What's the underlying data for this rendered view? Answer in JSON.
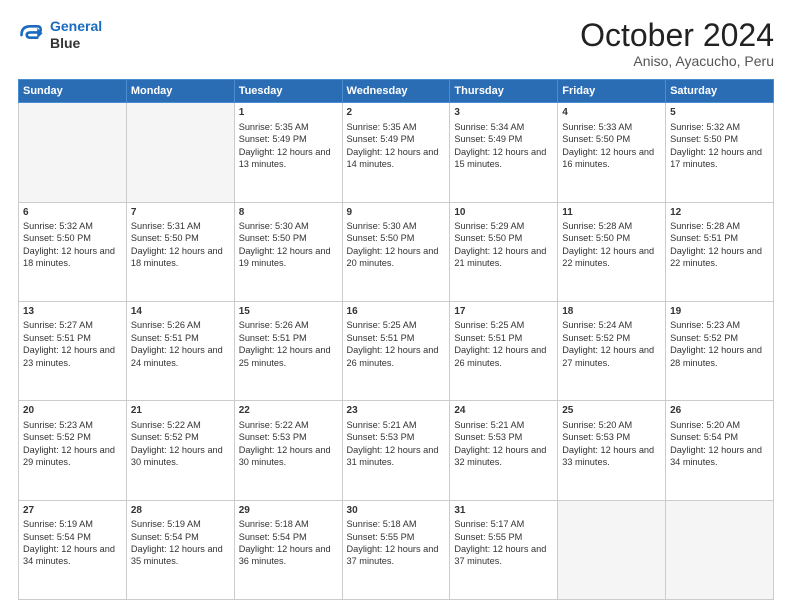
{
  "logo": {
    "line1": "General",
    "line2": "Blue"
  },
  "title": "October 2024",
  "subtitle": "Aniso, Ayacucho, Peru",
  "weekdays": [
    "Sunday",
    "Monday",
    "Tuesday",
    "Wednesday",
    "Thursday",
    "Friday",
    "Saturday"
  ],
  "weeks": [
    [
      {
        "day": "",
        "empty": true
      },
      {
        "day": "",
        "empty": true
      },
      {
        "day": "1",
        "sunrise": "Sunrise: 5:35 AM",
        "sunset": "Sunset: 5:49 PM",
        "daylight": "Daylight: 12 hours and 13 minutes."
      },
      {
        "day": "2",
        "sunrise": "Sunrise: 5:35 AM",
        "sunset": "Sunset: 5:49 PM",
        "daylight": "Daylight: 12 hours and 14 minutes."
      },
      {
        "day": "3",
        "sunrise": "Sunrise: 5:34 AM",
        "sunset": "Sunset: 5:49 PM",
        "daylight": "Daylight: 12 hours and 15 minutes."
      },
      {
        "day": "4",
        "sunrise": "Sunrise: 5:33 AM",
        "sunset": "Sunset: 5:50 PM",
        "daylight": "Daylight: 12 hours and 16 minutes."
      },
      {
        "day": "5",
        "sunrise": "Sunrise: 5:32 AM",
        "sunset": "Sunset: 5:50 PM",
        "daylight": "Daylight: 12 hours and 17 minutes."
      }
    ],
    [
      {
        "day": "6",
        "sunrise": "Sunrise: 5:32 AM",
        "sunset": "Sunset: 5:50 PM",
        "daylight": "Daylight: 12 hours and 18 minutes."
      },
      {
        "day": "7",
        "sunrise": "Sunrise: 5:31 AM",
        "sunset": "Sunset: 5:50 PM",
        "daylight": "Daylight: 12 hours and 18 minutes."
      },
      {
        "day": "8",
        "sunrise": "Sunrise: 5:30 AM",
        "sunset": "Sunset: 5:50 PM",
        "daylight": "Daylight: 12 hours and 19 minutes."
      },
      {
        "day": "9",
        "sunrise": "Sunrise: 5:30 AM",
        "sunset": "Sunset: 5:50 PM",
        "daylight": "Daylight: 12 hours and 20 minutes."
      },
      {
        "day": "10",
        "sunrise": "Sunrise: 5:29 AM",
        "sunset": "Sunset: 5:50 PM",
        "daylight": "Daylight: 12 hours and 21 minutes."
      },
      {
        "day": "11",
        "sunrise": "Sunrise: 5:28 AM",
        "sunset": "Sunset: 5:50 PM",
        "daylight": "Daylight: 12 hours and 22 minutes."
      },
      {
        "day": "12",
        "sunrise": "Sunrise: 5:28 AM",
        "sunset": "Sunset: 5:51 PM",
        "daylight": "Daylight: 12 hours and 22 minutes."
      }
    ],
    [
      {
        "day": "13",
        "sunrise": "Sunrise: 5:27 AM",
        "sunset": "Sunset: 5:51 PM",
        "daylight": "Daylight: 12 hours and 23 minutes."
      },
      {
        "day": "14",
        "sunrise": "Sunrise: 5:26 AM",
        "sunset": "Sunset: 5:51 PM",
        "daylight": "Daylight: 12 hours and 24 minutes."
      },
      {
        "day": "15",
        "sunrise": "Sunrise: 5:26 AM",
        "sunset": "Sunset: 5:51 PM",
        "daylight": "Daylight: 12 hours and 25 minutes."
      },
      {
        "day": "16",
        "sunrise": "Sunrise: 5:25 AM",
        "sunset": "Sunset: 5:51 PM",
        "daylight": "Daylight: 12 hours and 26 minutes."
      },
      {
        "day": "17",
        "sunrise": "Sunrise: 5:25 AM",
        "sunset": "Sunset: 5:51 PM",
        "daylight": "Daylight: 12 hours and 26 minutes."
      },
      {
        "day": "18",
        "sunrise": "Sunrise: 5:24 AM",
        "sunset": "Sunset: 5:52 PM",
        "daylight": "Daylight: 12 hours and 27 minutes."
      },
      {
        "day": "19",
        "sunrise": "Sunrise: 5:23 AM",
        "sunset": "Sunset: 5:52 PM",
        "daylight": "Daylight: 12 hours and 28 minutes."
      }
    ],
    [
      {
        "day": "20",
        "sunrise": "Sunrise: 5:23 AM",
        "sunset": "Sunset: 5:52 PM",
        "daylight": "Daylight: 12 hours and 29 minutes."
      },
      {
        "day": "21",
        "sunrise": "Sunrise: 5:22 AM",
        "sunset": "Sunset: 5:52 PM",
        "daylight": "Daylight: 12 hours and 30 minutes."
      },
      {
        "day": "22",
        "sunrise": "Sunrise: 5:22 AM",
        "sunset": "Sunset: 5:53 PM",
        "daylight": "Daylight: 12 hours and 30 minutes."
      },
      {
        "day": "23",
        "sunrise": "Sunrise: 5:21 AM",
        "sunset": "Sunset: 5:53 PM",
        "daylight": "Daylight: 12 hours and 31 minutes."
      },
      {
        "day": "24",
        "sunrise": "Sunrise: 5:21 AM",
        "sunset": "Sunset: 5:53 PM",
        "daylight": "Daylight: 12 hours and 32 minutes."
      },
      {
        "day": "25",
        "sunrise": "Sunrise: 5:20 AM",
        "sunset": "Sunset: 5:53 PM",
        "daylight": "Daylight: 12 hours and 33 minutes."
      },
      {
        "day": "26",
        "sunrise": "Sunrise: 5:20 AM",
        "sunset": "Sunset: 5:54 PM",
        "daylight": "Daylight: 12 hours and 34 minutes."
      }
    ],
    [
      {
        "day": "27",
        "sunrise": "Sunrise: 5:19 AM",
        "sunset": "Sunset: 5:54 PM",
        "daylight": "Daylight: 12 hours and 34 minutes."
      },
      {
        "day": "28",
        "sunrise": "Sunrise: 5:19 AM",
        "sunset": "Sunset: 5:54 PM",
        "daylight": "Daylight: 12 hours and 35 minutes."
      },
      {
        "day": "29",
        "sunrise": "Sunrise: 5:18 AM",
        "sunset": "Sunset: 5:54 PM",
        "daylight": "Daylight: 12 hours and 36 minutes."
      },
      {
        "day": "30",
        "sunrise": "Sunrise: 5:18 AM",
        "sunset": "Sunset: 5:55 PM",
        "daylight": "Daylight: 12 hours and 37 minutes."
      },
      {
        "day": "31",
        "sunrise": "Sunrise: 5:17 AM",
        "sunset": "Sunset: 5:55 PM",
        "daylight": "Daylight: 12 hours and 37 minutes."
      },
      {
        "day": "",
        "empty": true
      },
      {
        "day": "",
        "empty": true
      }
    ]
  ]
}
